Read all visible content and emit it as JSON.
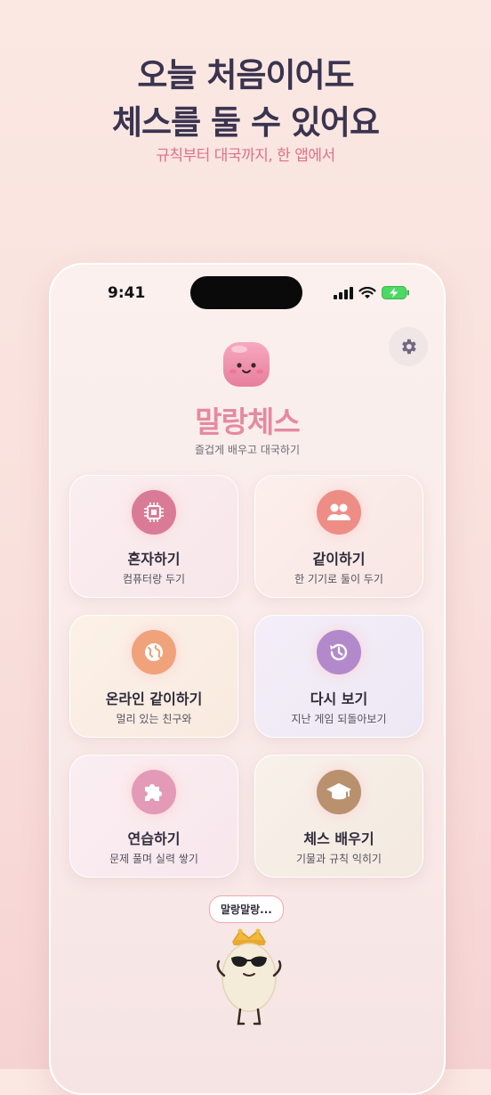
{
  "promo": {
    "headline_line1": "오늘 처음이어도",
    "headline_line2": "체스를 둘 수 있어요",
    "subheadline": "규칙부터 대국까지, 한 앱에서"
  },
  "status_bar": {
    "time": "9:41"
  },
  "app": {
    "title": "말랑체스",
    "subtitle": "즐겁게 배우고 대국하기"
  },
  "menu": [
    {
      "title": "혼자하기",
      "desc": "컴퓨터랑 두기",
      "icon": "chip-icon",
      "color": "#d97b96"
    },
    {
      "title": "같이하기",
      "desc": "한 기기로 둘이 두기",
      "icon": "people-icon",
      "color": "#ee8d86"
    },
    {
      "title": "온라인 같이하기",
      "desc": "멀리 있는 친구와",
      "icon": "globe-icon",
      "color": "#f0a27a"
    },
    {
      "title": "다시 보기",
      "desc": "지난 게임 되돌아보기",
      "icon": "history-icon",
      "color": "#b28acb"
    },
    {
      "title": "연습하기",
      "desc": "문제 풀며 실력 쌓기",
      "icon": "puzzle-icon",
      "color": "#e39ab6"
    },
    {
      "title": "체스 배우기",
      "desc": "기물과 규칙 익히기",
      "icon": "graduation-cap-icon",
      "color": "#b9916e"
    }
  ],
  "mascot": {
    "speech": "말랑말랑..."
  },
  "colors": {
    "accent": "#e58aa0",
    "headline": "#3a3450"
  }
}
